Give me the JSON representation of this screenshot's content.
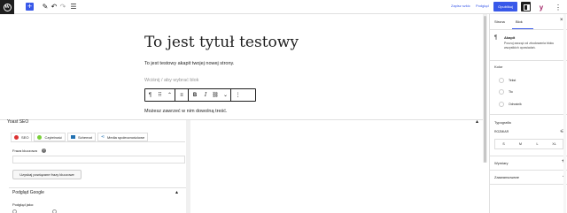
{
  "topbar": {
    "logo_letter": "W",
    "add_icon": "plus",
    "links": {
      "save_draft": "Zapisz szkic",
      "preview": "Podgląd"
    },
    "publish": "Opublikuj",
    "yoast_icon": "y",
    "more_icon": "⋮"
  },
  "editor": {
    "title": "To jest tytuł testowy",
    "paragraph": "To jest testowy akapit twojej nowej strony.",
    "placeholder": "Wciśnij / aby wybrać blok",
    "paragraph2": "Możesz zawrzeć w nim dowolną treść.",
    "toolbar": {
      "paragraph_icon": "¶",
      "drag_icon": "⠿",
      "move_icon": "⌃",
      "align_icon": "≡",
      "bold": "B",
      "italic": "I",
      "link_icon": "⛓",
      "more_rich_icon": "⌄",
      "options_icon": "⋮"
    }
  },
  "yoast": {
    "title": "Yoast SEO",
    "caret": "▴",
    "tabs": [
      {
        "label": "SEO",
        "dot_color": "#dc3232"
      },
      {
        "label": "Czytelność",
        "dot_color": "#7ad03a"
      },
      {
        "label": "Schemat",
        "icon_color": "#2271b1"
      },
      {
        "label": "Media społecznościowe",
        "icon_color": "#2271b1"
      }
    ],
    "keyphrase_label": "Fraza kluczowa",
    "help": "?",
    "related_button": "Uzyskaj powiązane frazy kluczowe",
    "google_preview": "Podgląd Google",
    "preview_as": "Podgląd jako:"
  },
  "sidebar": {
    "tabs": [
      "Strona",
      "Blok"
    ],
    "close": "×",
    "block_icon": "¶",
    "block_name": "Akapit",
    "block_desc": "Poczuj zacząć od zbudowania bloku wszystkich opowiadań.",
    "color_heading": "Kolor",
    "colors": [
      "Tekst",
      "Tło",
      "Odnośnik"
    ],
    "typography_heading": "Typografia",
    "size_label": "ROZMIAR",
    "sizes": [
      "S",
      "M",
      "L",
      "XL"
    ],
    "dimensions_heading": "Wymiary",
    "advanced_heading": "Zaawansowane",
    "more_icon": "⋮",
    "plus_icon": "+",
    "chevron_icon": "⌄"
  },
  "colors": {
    "accent": "#3858e9",
    "yoast": "#a4286a"
  }
}
